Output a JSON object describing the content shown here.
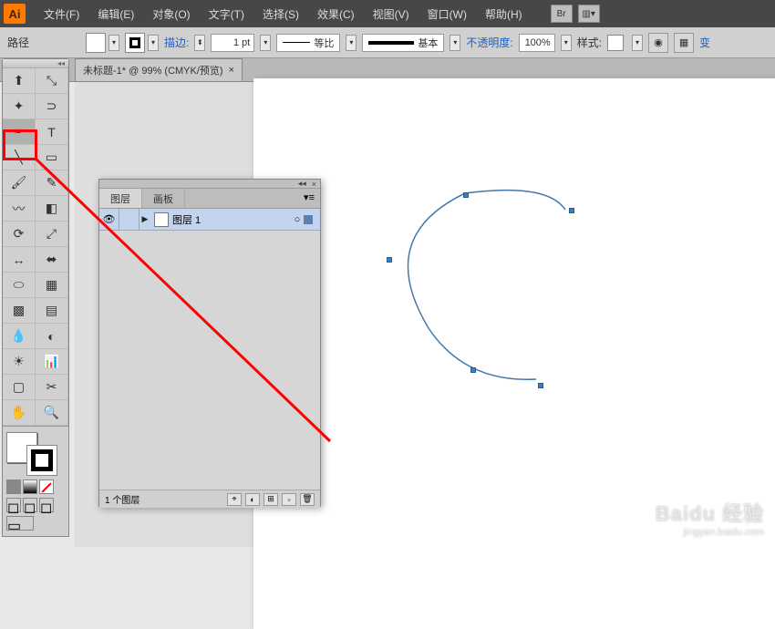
{
  "logo": "Ai",
  "menu": {
    "file": "文件(F)",
    "edit": "编辑(E)",
    "object": "对象(O)",
    "text": "文字(T)",
    "select": "选择(S)",
    "effect": "效果(C)",
    "view": "视图(V)",
    "window": "窗口(W)",
    "help": "帮助(H)",
    "br": "Br"
  },
  "options": {
    "path_label": "路径",
    "stroke_label": "描边:",
    "stroke_value": "1 pt",
    "profile_label": "等比",
    "brush_label": "基本",
    "opacity_label": "不透明度:",
    "opacity_value": "100%",
    "style_label": "样式:",
    "transform_label": "变"
  },
  "tab": {
    "title": "未标题-1* @ 99% (CMYK/预览)",
    "close": "×"
  },
  "layers_panel": {
    "tab_layers": "图层",
    "tab_artboards": "画板",
    "layer1": "图层 1",
    "footer": "1 个图层",
    "close": "×",
    "collapse": "◂◂"
  },
  "tools": {
    "selection": "⬆",
    "direct": "⤡",
    "magic": "✦",
    "lasso": "⊃",
    "pen": "✒",
    "type": "T",
    "line": "╲",
    "rect": "▭",
    "brush": "🖌",
    "pencil": "✎",
    "blob": "〰",
    "eraser": "◧",
    "rotate": "⟳",
    "scale": "⤢",
    "width": "↔",
    "free": "⬌",
    "shape": "⬭",
    "persp": "▦",
    "mesh": "▩",
    "gradient": "▤",
    "eyedrop": "💧",
    "blend": "◐",
    "symbol": "☀",
    "graph": "📊",
    "artboard": "▢",
    "slice": "✂",
    "hand": "✋",
    "zoom": "🔍"
  },
  "watermark": {
    "brand": "Baidu 经验",
    "url": "jingyan.baidu.com"
  }
}
